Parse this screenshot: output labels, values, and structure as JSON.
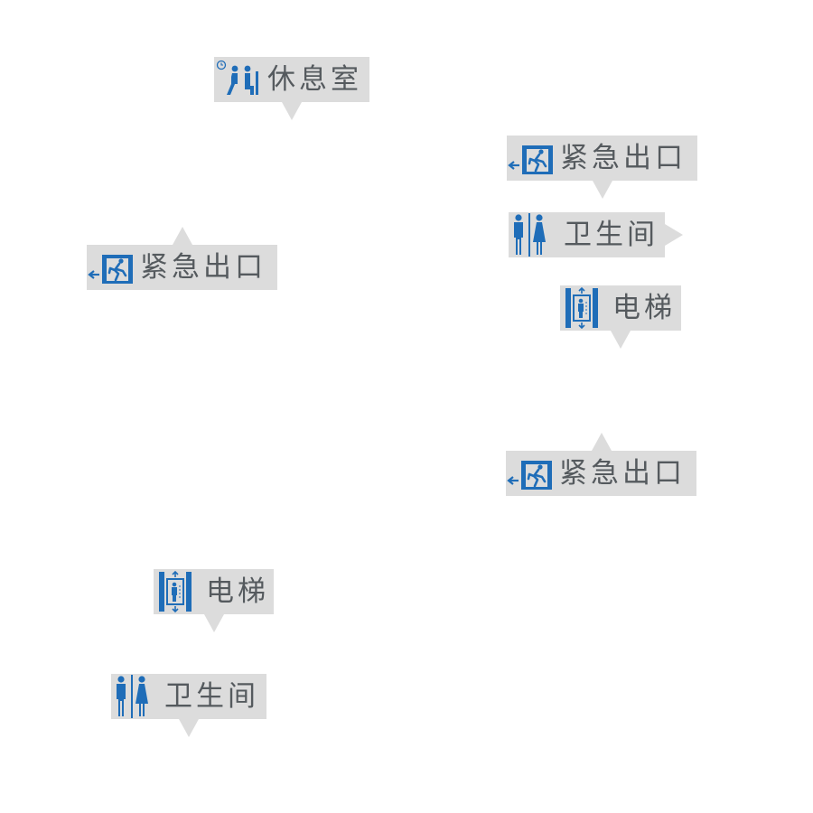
{
  "colors": {
    "sign_background": "#dcdcdc",
    "icon_blue": "#1f6db8",
    "label_gray": "#555a5e"
  },
  "signs": [
    {
      "id": "lounge",
      "label": "休息室",
      "icon": "waiting-lounge-icon",
      "pointer": "down"
    },
    {
      "id": "exit-1",
      "label": "紧急出口",
      "icon": "emergency-exit-icon",
      "pointer": "down"
    },
    {
      "id": "restroom-1",
      "label": "卫生间",
      "icon": "restroom-icon",
      "pointer": "right"
    },
    {
      "id": "elevator-1",
      "label": "电梯",
      "icon": "elevator-icon",
      "pointer": "down"
    },
    {
      "id": "exit-2",
      "label": "紧急出口",
      "icon": "emergency-exit-icon",
      "pointer": "up"
    },
    {
      "id": "exit-3",
      "label": "紧急出口",
      "icon": "emergency-exit-icon",
      "pointer": "up"
    },
    {
      "id": "elevator-2",
      "label": "电梯",
      "icon": "elevator-icon",
      "pointer": "down"
    },
    {
      "id": "restroom-2",
      "label": "卫生间",
      "icon": "restroom-icon",
      "pointer": "down"
    }
  ]
}
